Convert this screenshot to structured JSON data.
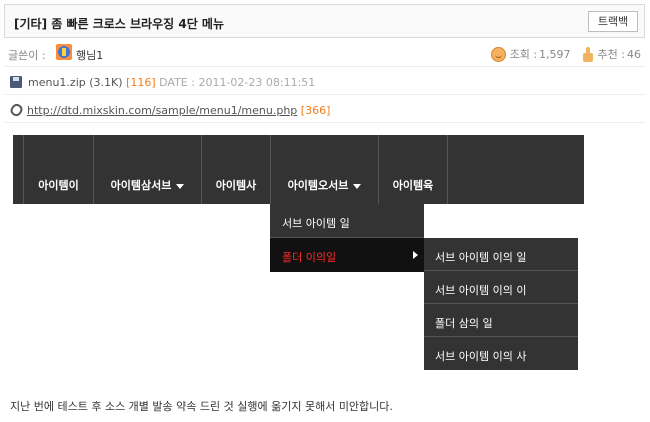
{
  "post": {
    "title": "[기타] 좀 빠른 크로스 브라우징 4단 메뉴",
    "trackback_label": "트랙백"
  },
  "author": {
    "label": "글쓴이 :",
    "name": "행님1",
    "views_label": "조회 :",
    "views": "1,597",
    "recommend_label": "추천 :",
    "recommend": "46"
  },
  "attachment": {
    "filename": "menu1.zip",
    "size": "(3.1K)",
    "downloads": "[116]",
    "date_label": "DATE :",
    "date": "2011-02-23 08:11:51"
  },
  "link": {
    "url": "http://dtd.mixskin.com/sample/menu1/menu.php",
    "hits": "[366]"
  },
  "menu": {
    "items": [
      {
        "label": "아이템이",
        "has_sub": false
      },
      {
        "label": "아이템삼서브",
        "has_sub": true
      },
      {
        "label": "아이템사",
        "has_sub": false
      },
      {
        "label": "아이템오서브",
        "has_sub": true
      },
      {
        "label": "아이템육",
        "has_sub": false
      }
    ],
    "submenu_level2": [
      "서브 아이템 일",
      "폴더 이의일"
    ],
    "submenu_level3": [
      "서브 아이템 이의 일",
      "서브 아이템 이의 이",
      "폴더 삼의 일",
      "서브 아이템 이의 사"
    ],
    "active_color": "#ff2a2a",
    "bg_color": "#333333"
  },
  "body": {
    "text": "지난 번에 테스트 후 소스 개별 발송 약속 드린 것 실행에 옮기지 못해서 미안합니다."
  }
}
